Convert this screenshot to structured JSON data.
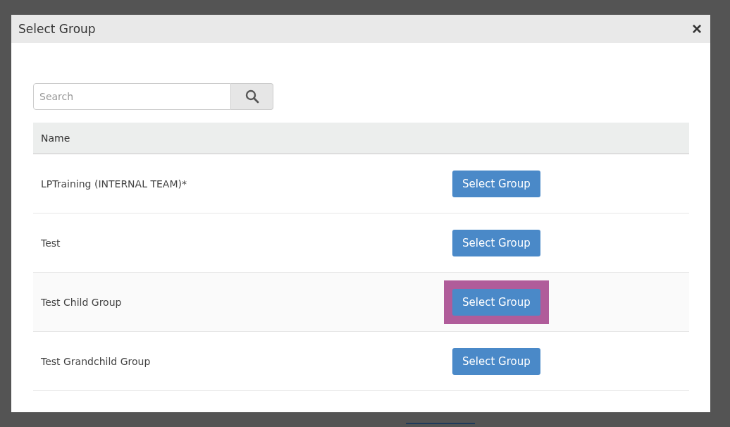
{
  "dialog": {
    "title": "Select Group",
    "close": "×"
  },
  "search": {
    "placeholder": "Search"
  },
  "table": {
    "columns": [
      "Name"
    ],
    "rows": [
      {
        "name": "LPTraining (INTERNAL TEAM)*",
        "action": "Select Group",
        "highlighted": false
      },
      {
        "name": "Test",
        "action": "Select Group",
        "highlighted": false
      },
      {
        "name": "Test Child Group",
        "action": "Select Group",
        "highlighted": true
      },
      {
        "name": "Test Grandchild Group",
        "action": "Select Group",
        "highlighted": false
      }
    ]
  }
}
